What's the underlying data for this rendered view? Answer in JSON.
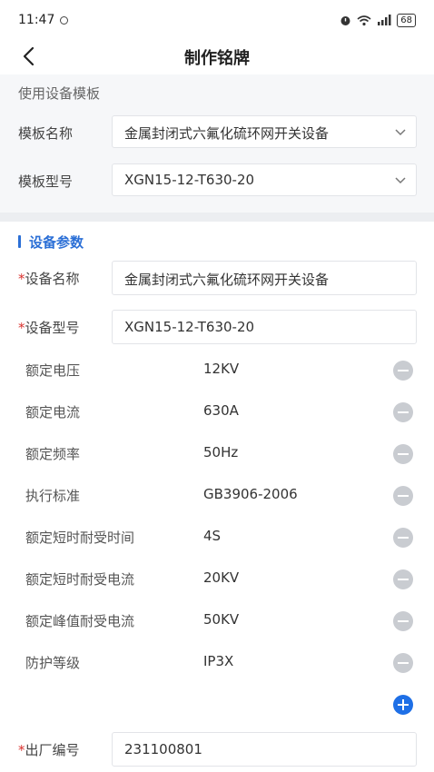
{
  "status": {
    "time": "11:47",
    "battery": "68"
  },
  "nav": {
    "title": "制作铭牌"
  },
  "template": {
    "section_label": "使用设备模板",
    "name_label": "模板名称",
    "name_value": "金属封闭式六氟化硫环网开关设备",
    "model_label": "模板型号",
    "model_value": "XGN15-12-T630-20"
  },
  "params": {
    "title": "设备参数",
    "required_mark": "*",
    "device_name_label": "设备名称",
    "device_name_value": "金属封闭式六氟化硫环网开关设备",
    "device_model_label": "设备型号",
    "device_model_value": "XGN15-12-T630-20",
    "items": [
      {
        "key": "额定电压",
        "value": "12KV"
      },
      {
        "key": "额定电流",
        "value": "630A"
      },
      {
        "key": "额定频率",
        "value": "50Hz"
      },
      {
        "key": "执行标准",
        "value": "GB3906-2006"
      },
      {
        "key": "额定短时耐受时间",
        "value": "4S"
      },
      {
        "key": "额定短时耐受电流",
        "value": "20KV"
      },
      {
        "key": "额定峰值耐受电流",
        "value": "50KV"
      },
      {
        "key": "防护等级",
        "value": "IP3X"
      }
    ],
    "serial_label": "出厂编号",
    "serial_value": "231100801"
  }
}
